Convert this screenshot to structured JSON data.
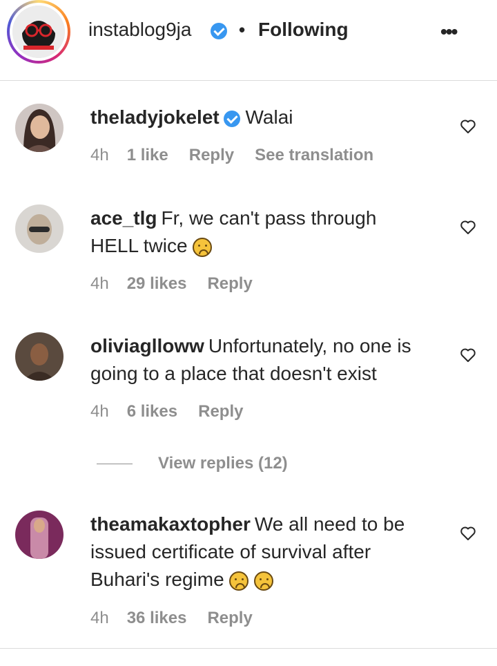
{
  "header": {
    "account": "instablog9ja",
    "separator": "•",
    "follow_status": "Following",
    "more_label": "•••"
  },
  "comments": [
    {
      "user": "theladyjokelet",
      "verified": true,
      "text": "Walai",
      "time": "4h",
      "likes": "1 like",
      "reply": "Reply",
      "translate": "See translation"
    },
    {
      "user": "ace_tlg",
      "text": "Fr, we can't pass through HELL twice",
      "emojis": [
        "sad-face-emoji"
      ],
      "time": "4h",
      "likes": "29 likes",
      "reply": "Reply"
    },
    {
      "user": "oliviaglloww",
      "text": "Unfortunately, no one is going to a place that doesn't exist",
      "time": "4h",
      "likes": "6 likes",
      "reply": "Reply",
      "view_replies": "View replies (12)"
    },
    {
      "user": "theamakaxtopher",
      "text": "We all need to be issued certificate of survival after Buhari's regime",
      "emojis": [
        "weary-face-emoji",
        "frown-face-emoji"
      ],
      "time": "4h",
      "likes": "36 likes",
      "reply": "Reply"
    }
  ],
  "colors": {
    "verified": "#3897f0",
    "muted": "#8e8e8e",
    "text": "#262626"
  }
}
